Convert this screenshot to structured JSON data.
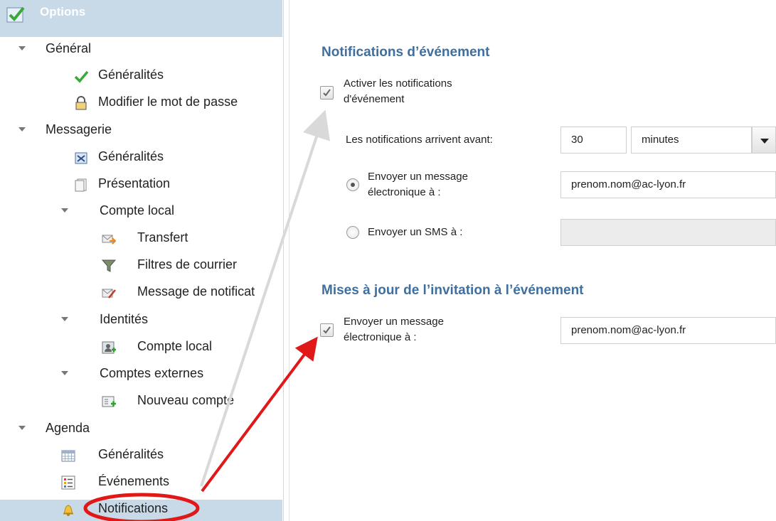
{
  "sidebar": {
    "header_title": "Options",
    "general": {
      "label": "Général",
      "items": [
        "Généralités",
        "Modifier le mot de passe"
      ]
    },
    "messagerie": {
      "label": "Messagerie",
      "items": [
        "Généralités",
        "Présentation"
      ],
      "compte_local": {
        "label": "Compte local",
        "items": [
          "Transfert",
          "Filtres de courrier",
          "Message de notificat"
        ]
      },
      "identites": {
        "label": "Identités",
        "items": [
          "Compte local"
        ]
      },
      "comptes_externes": {
        "label": "Comptes externes",
        "items": [
          "Nouveau compte"
        ]
      }
    },
    "agenda": {
      "label": "Agenda",
      "items": [
        "Généralités",
        "Événements",
        "Notifications"
      ]
    }
  },
  "main": {
    "event_notifications": {
      "title": "Notifications d’événement",
      "enable_label_line1": "Activer les notifications",
      "enable_label_line2": "d'événement",
      "arrive_before_label": "Les notifications arrivent avant:",
      "arrive_before_value": "30",
      "unit_value": "minutes",
      "email_label_line1": "Envoyer un message",
      "email_label_line2": "électronique à :",
      "email_value": "prenom.nom@ac-lyon.fr",
      "sms_label": "Envoyer un SMS à :",
      "sms_value": ""
    },
    "invitation_updates": {
      "title": "Mises à jour de l’invitation à l’événement",
      "email_label_line1": "Envoyer un message",
      "email_label_line2": "électronique à :",
      "email_value": "prenom.nom@ac-lyon.fr"
    }
  },
  "colors": {
    "sidebar_header": "#c8d9e8",
    "section_title": "#3f6f9e",
    "annotation_red": "#e11818",
    "annotation_gray": "#d9d9d9"
  }
}
